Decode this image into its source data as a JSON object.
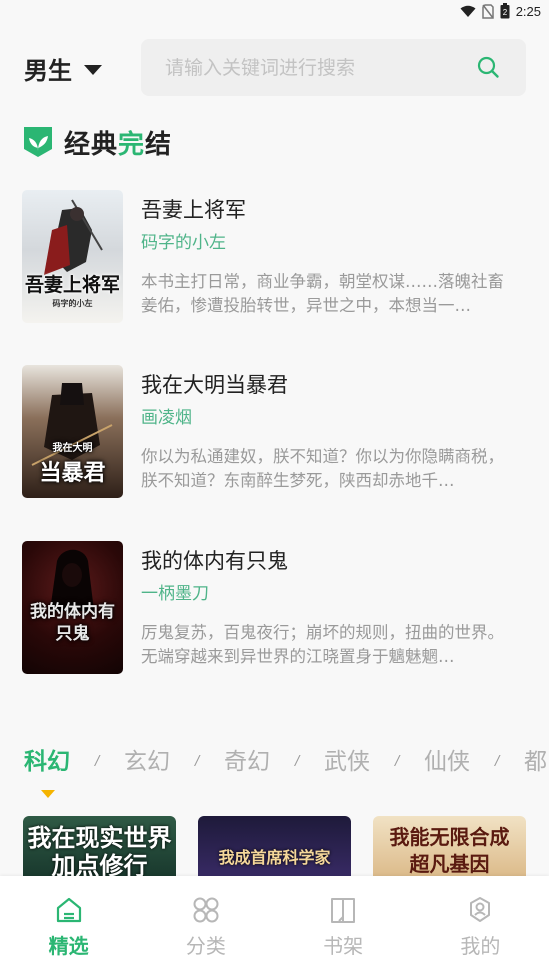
{
  "status_bar": {
    "time": "2:25",
    "battery_level": "2"
  },
  "header": {
    "gender": "男生",
    "search_placeholder": "请输入关键词进行搜索"
  },
  "section": {
    "title_part1": "经典",
    "title_highlight": "完",
    "title_part2": "结"
  },
  "books": [
    {
      "title": "吾妻上将军",
      "author": "码字的小左",
      "desc": "本书主打日常，商业争霸，朝堂权谋……落魄社畜姜佑，惨遭投胎转世，异世之中，本想当一…",
      "cover_text": "吾妻上将军",
      "cover_sub": "码字的小左"
    },
    {
      "title": "我在大明当暴君",
      "author": "画凌烟",
      "desc": "你以为私通建奴，朕不知道？你以为你隐瞒商税，朕不知道？东南醉生梦死，陕西却赤地千…",
      "cover_text": "当暴君",
      "cover_sub": "我在大明"
    },
    {
      "title": "我的体内有只鬼",
      "author": "一柄墨刀",
      "desc": "厉鬼复苏，百鬼夜行；崩坏的规则，扭曲的世界。无端穿越来到异世界的江晓置身于魑魅魍…",
      "cover_text": "我的体内有只鬼",
      "cover_sub": ""
    }
  ],
  "categories": [
    "科幻",
    "玄幻",
    "奇幻",
    "武侠",
    "仙侠",
    "都"
  ],
  "category_separator": "/",
  "recommend": [
    {
      "cover_text": "我在现实世界加点修行"
    },
    {
      "cover_text": "我成首席科学家"
    },
    {
      "cover_text": "我能无限合成超凡基因"
    }
  ],
  "nav": [
    {
      "label": "精选",
      "icon": "home-icon"
    },
    {
      "label": "分类",
      "icon": "category-grid-icon"
    },
    {
      "label": "书架",
      "icon": "bookshelf-icon"
    },
    {
      "label": "我的",
      "icon": "profile-gear-icon"
    }
  ],
  "colors": {
    "accent": "#2bb673",
    "author": "#4fb489",
    "indicator": "#f5b400"
  }
}
